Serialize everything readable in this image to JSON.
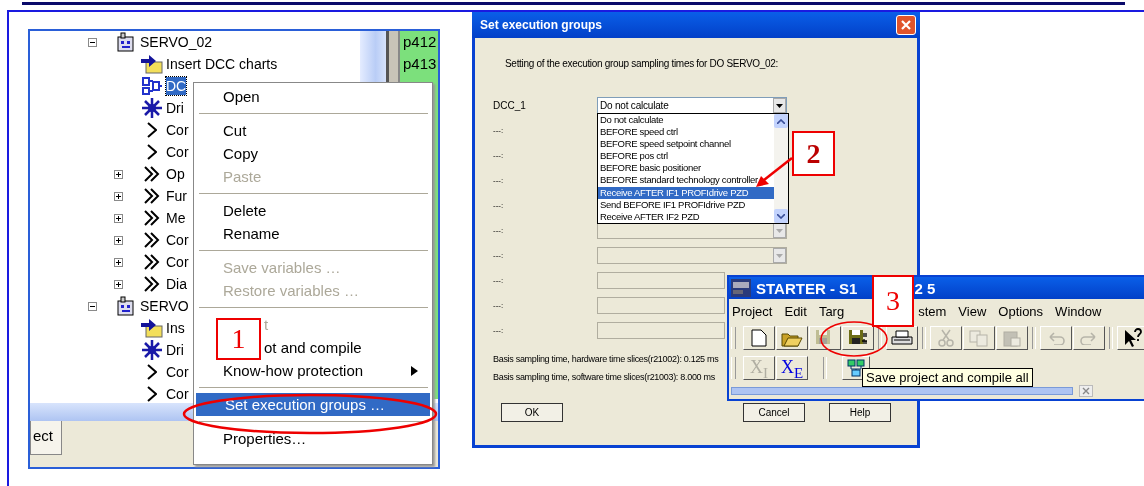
{
  "tree": [
    {
      "label": "SERVO_02",
      "kind": "device",
      "expanded": true,
      "selected": false,
      "children": [
        {
          "label": "Insert DCC charts",
          "kind": "insert",
          "selected": false
        },
        {
          "label": "DC",
          "kind": "dcc",
          "selected": true
        },
        {
          "label": "Dri",
          "kind": "drive",
          "selected": false
        },
        {
          "label": "Cor",
          "kind": "single",
          "selected": false
        },
        {
          "label": "Cor",
          "kind": "single",
          "selected": false
        },
        {
          "label": "Op",
          "kind": "double",
          "expanded": false,
          "selected": false
        },
        {
          "label": "Fur",
          "kind": "double",
          "expanded": false,
          "selected": false
        },
        {
          "label": "Me",
          "kind": "double",
          "expanded": false,
          "selected": false
        },
        {
          "label": "Cor",
          "kind": "double",
          "expanded": false,
          "selected": false
        },
        {
          "label": "Cor",
          "kind": "double",
          "expanded": false,
          "selected": false
        },
        {
          "label": "Dia",
          "kind": "double",
          "expanded": false,
          "selected": false
        }
      ]
    },
    {
      "label": "SERVO",
      "kind": "device",
      "expanded": true,
      "selected": false,
      "children": [
        {
          "label": "Ins",
          "kind": "insert",
          "selected": false
        },
        {
          "label": "Dri",
          "kind": "drive",
          "selected": false
        },
        {
          "label": "Cor",
          "kind": "single",
          "selected": false
        },
        {
          "label": "Cor",
          "kind": "single",
          "selected": false
        }
      ]
    }
  ],
  "param_column": [
    "p412",
    "p413"
  ],
  "bottom_tab": "ect",
  "context_menu": [
    {
      "kind": "item",
      "label": "Open",
      "disabled": false,
      "selected": false
    },
    {
      "kind": "separator"
    },
    {
      "kind": "item",
      "label": "Cut",
      "disabled": false,
      "selected": false
    },
    {
      "kind": "item",
      "label": "Copy",
      "disabled": false,
      "selected": false
    },
    {
      "kind": "item",
      "label": "Paste",
      "disabled": true,
      "selected": false
    },
    {
      "kind": "separator"
    },
    {
      "kind": "item",
      "label": "Delete",
      "disabled": false,
      "selected": false
    },
    {
      "kind": "item",
      "label": "Rename",
      "disabled": false,
      "selected": false
    },
    {
      "kind": "separator"
    },
    {
      "kind": "item",
      "label": "Save variables …",
      "disabled": true,
      "selected": false
    },
    {
      "kind": "item",
      "label": "Restore variables …",
      "disabled": true,
      "selected": false
    },
    {
      "kind": "separator"
    },
    {
      "kind": "covered",
      "label": "t",
      "disabled": true,
      "selected": false
    },
    {
      "kind": "covered",
      "label": "ot and compile",
      "disabled": false,
      "selected": false
    },
    {
      "kind": "submenu",
      "label": "Know-how protection",
      "disabled": false,
      "selected": false
    },
    {
      "kind": "separator"
    },
    {
      "kind": "item",
      "label": "Set execution groups …",
      "disabled": false,
      "selected": true
    },
    {
      "kind": "separator"
    },
    {
      "kind": "item",
      "label": "Properties…",
      "disabled": false,
      "selected": false
    }
  ],
  "callouts": [
    "1",
    "2",
    "3"
  ],
  "dialog": {
    "title": "Set execution groups",
    "intro": "Setting of the execution group sampling times for DO  SERVO_02:",
    "dcc_label": "DCC_1",
    "dcc_value": "Do not calculate",
    "options": [
      {
        "label": "Do not calculate",
        "selected": false
      },
      {
        "label": "BEFORE speed ctrl",
        "selected": false
      },
      {
        "label": "BEFORE speed setpoint channel",
        "selected": false
      },
      {
        "label": "BEFORE pos ctrl",
        "selected": false
      },
      {
        "label": "BEFORE basic positioner",
        "selected": false
      },
      {
        "label": "BEFORE standard technology controller",
        "selected": false
      },
      {
        "label": "Receive AFTER IF1 PROFIdrive PZD",
        "selected": true
      },
      {
        "label": "Send BEFORE IF1 PROFIdrive PZD",
        "selected": false
      },
      {
        "label": "Receive AFTER IF2 PZD",
        "selected": false
      }
    ],
    "rows": [
      {
        "label": "---:",
        "kind": "hidden"
      },
      {
        "label": "---:",
        "kind": "hidden"
      },
      {
        "label": "---:",
        "kind": "hidden"
      },
      {
        "label": "---:",
        "kind": "hidden"
      },
      {
        "label": "---:",
        "kind": "combo"
      },
      {
        "label": "---:",
        "kind": "combo"
      },
      {
        "label": "---:",
        "kind": "field"
      },
      {
        "label": "---:",
        "kind": "field"
      },
      {
        "label": "---:",
        "kind": "field"
      }
    ],
    "notes": [
      "Basis sampling time, hardware time slices(r21002): 0.125 ms",
      "Basis sampling time, software time slices(r21003): 8.000 ms"
    ],
    "buttons": [
      "OK",
      "Cancel",
      "Help"
    ]
  },
  "starter": {
    "title_left": "STARTER - S1",
    "title_right": "2 5",
    "menu": [
      "Project",
      "Edit",
      "Targ",
      "stem",
      "View",
      "Options",
      "Window"
    ],
    "toolbar": [
      {
        "kind": "new",
        "disabled": false
      },
      {
        "kind": "open",
        "disabled": false
      },
      {
        "kind": "save",
        "disabled": true
      },
      {
        "kind": "save-compile",
        "disabled": false
      },
      {
        "kind": "print",
        "disabled": false
      },
      {
        "kind": "cut",
        "disabled": true
      },
      {
        "kind": "copy",
        "disabled": true
      },
      {
        "kind": "paste",
        "disabled": true
      },
      {
        "kind": "undo",
        "disabled": true
      },
      {
        "kind": "redo",
        "disabled": true
      },
      {
        "kind": "help",
        "disabled": false
      }
    ],
    "toolbar2": [
      {
        "label": "X$_{I}$",
        "disabled": true
      },
      {
        "label": "X$_{E}$",
        "disabled": false
      }
    ],
    "tooltip": "Save project and compile all"
  }
}
